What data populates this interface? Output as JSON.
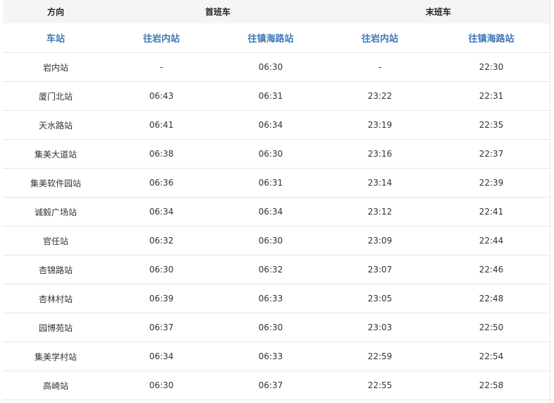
{
  "header": {
    "direction": "方向",
    "first_train": "首班车",
    "last_train": "末班车"
  },
  "subheader": {
    "station": "车站",
    "to_yannei": "往岩内站",
    "to_zhenhailu": "往镇海路站",
    "to_yannei_last": "往岩内站",
    "to_zhenhailu_last": "往镇海路站"
  },
  "rows": [
    {
      "station": "岩内站",
      "first_yannei": "-",
      "first_zhenhai": "06:30",
      "last_yannei": "-",
      "last_zhenhai": "22:30"
    },
    {
      "station": "厦门北站",
      "first_yannei": "06:43",
      "first_zhenhai": "06:31",
      "last_yannei": "23:22",
      "last_zhenhai": "22:31"
    },
    {
      "station": "天水路站",
      "first_yannei": "06:41",
      "first_zhenhai": "06:34",
      "last_yannei": "23:19",
      "last_zhenhai": "22:35"
    },
    {
      "station": "集美大道站",
      "first_yannei": "06:38",
      "first_zhenhai": "06:30",
      "last_yannei": "23:16",
      "last_zhenhai": "22:37"
    },
    {
      "station": "集美软件园站",
      "first_yannei": "06:36",
      "first_zhenhai": "06:31",
      "last_yannei": "23:14",
      "last_zhenhai": "22:39"
    },
    {
      "station": "诚毅广场站",
      "first_yannei": "06:34",
      "first_zhenhai": "06:34",
      "last_yannei": "23:12",
      "last_zhenhai": "22:41"
    },
    {
      "station": "官任站",
      "first_yannei": "06:32",
      "first_zhenhai": "06:30",
      "last_yannei": "23:09",
      "last_zhenhai": "22:44"
    },
    {
      "station": "杏锦路站",
      "first_yannei": "06:30",
      "first_zhenhai": "06:32",
      "last_yannei": "23:07",
      "last_zhenhai": "22:46"
    },
    {
      "station": "杏林村站",
      "first_yannei": "06:39",
      "first_zhenhai": "06:33",
      "last_yannei": "23:05",
      "last_zhenhai": "22:48"
    },
    {
      "station": "园博苑站",
      "first_yannei": "06:37",
      "first_zhenhai": "06:30",
      "last_yannei": "23:03",
      "last_zhenhai": "22:50"
    },
    {
      "station": "集美学村站",
      "first_yannei": "06:34",
      "first_zhenhai": "06:33",
      "last_yannei": "22:59",
      "last_zhenhai": "22:54"
    },
    {
      "station": "高崎站",
      "first_yannei": "06:30",
      "first_zhenhai": "06:37",
      "last_yannei": "22:55",
      "last_zhenhai": "22:58"
    }
  ]
}
